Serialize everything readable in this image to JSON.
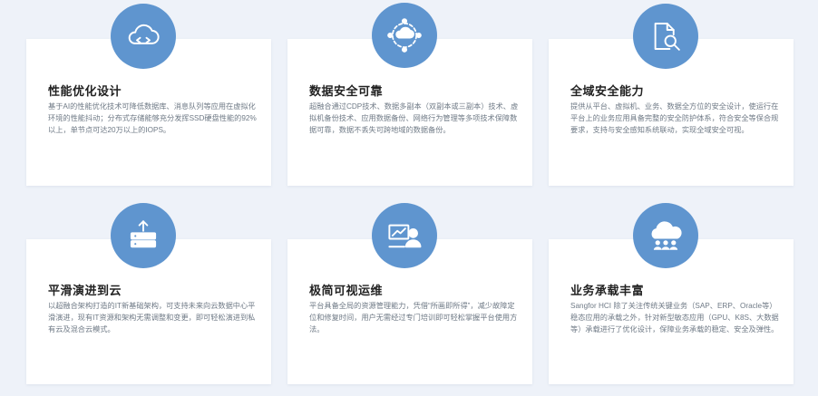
{
  "features": [
    {
      "icon": "cloud-icon",
      "title": "性能优化设计",
      "desc": "基于AI的性能优化技术可降低数据库、消息队列等应用在虚拟化环境的性能抖动；分布式存储能够充分发挥SSD硬盘性能的92%以上，单节点可达20万以上的IOPS。"
    },
    {
      "icon": "cloud-network-icon",
      "title": "数据安全可靠",
      "desc": "超融合通过CDP技术、数据多副本（双副本或三副本）技术、虚拟机备份技术、应用数据备份、网络行为管理等多项技术保障数据可靠，数据不丢失可跨地域的数据备份。"
    },
    {
      "icon": "document-search-icon",
      "title": "全域安全能力",
      "desc": "提供从平台、虚拟机、业务、数据全方位的安全设计，使运行在平台上的业务应用具备完整的安全防护体系，符合安全等保合规要求，支持与安全感知系统联动，实现全域安全可视。"
    },
    {
      "icon": "server-upload-icon",
      "title": "平滑演进到云",
      "desc": "以超融合架构打造的IT新基础架构，可支持未来向云数据中心平滑演进，现有IT资源和架构无需调整和变更，即可轻松演进到私有云及混合云模式。"
    },
    {
      "icon": "presentation-user-icon",
      "title": "极简可视运维",
      "desc": "平台具备全局的资源管理能力，凭借“所画即所得”，减少故障定位和修复时间，用户无需经过专门培训即可轻松掌握平台使用方法。"
    },
    {
      "icon": "cloud-users-icon",
      "title": "业务承载丰富",
      "desc": "Sangfor HCI 除了关注传统关键业务（SAP、ERP、Oracle等）稳态应用的承载之外，针对新型敏态应用（GPU、K8S、大数据等）承载进行了优化设计，保障业务承载的稳定、安全及弹性。"
    }
  ],
  "colors": {
    "badge": "#5f95cf",
    "card": "#ffffff",
    "background": "#eef2f9"
  }
}
